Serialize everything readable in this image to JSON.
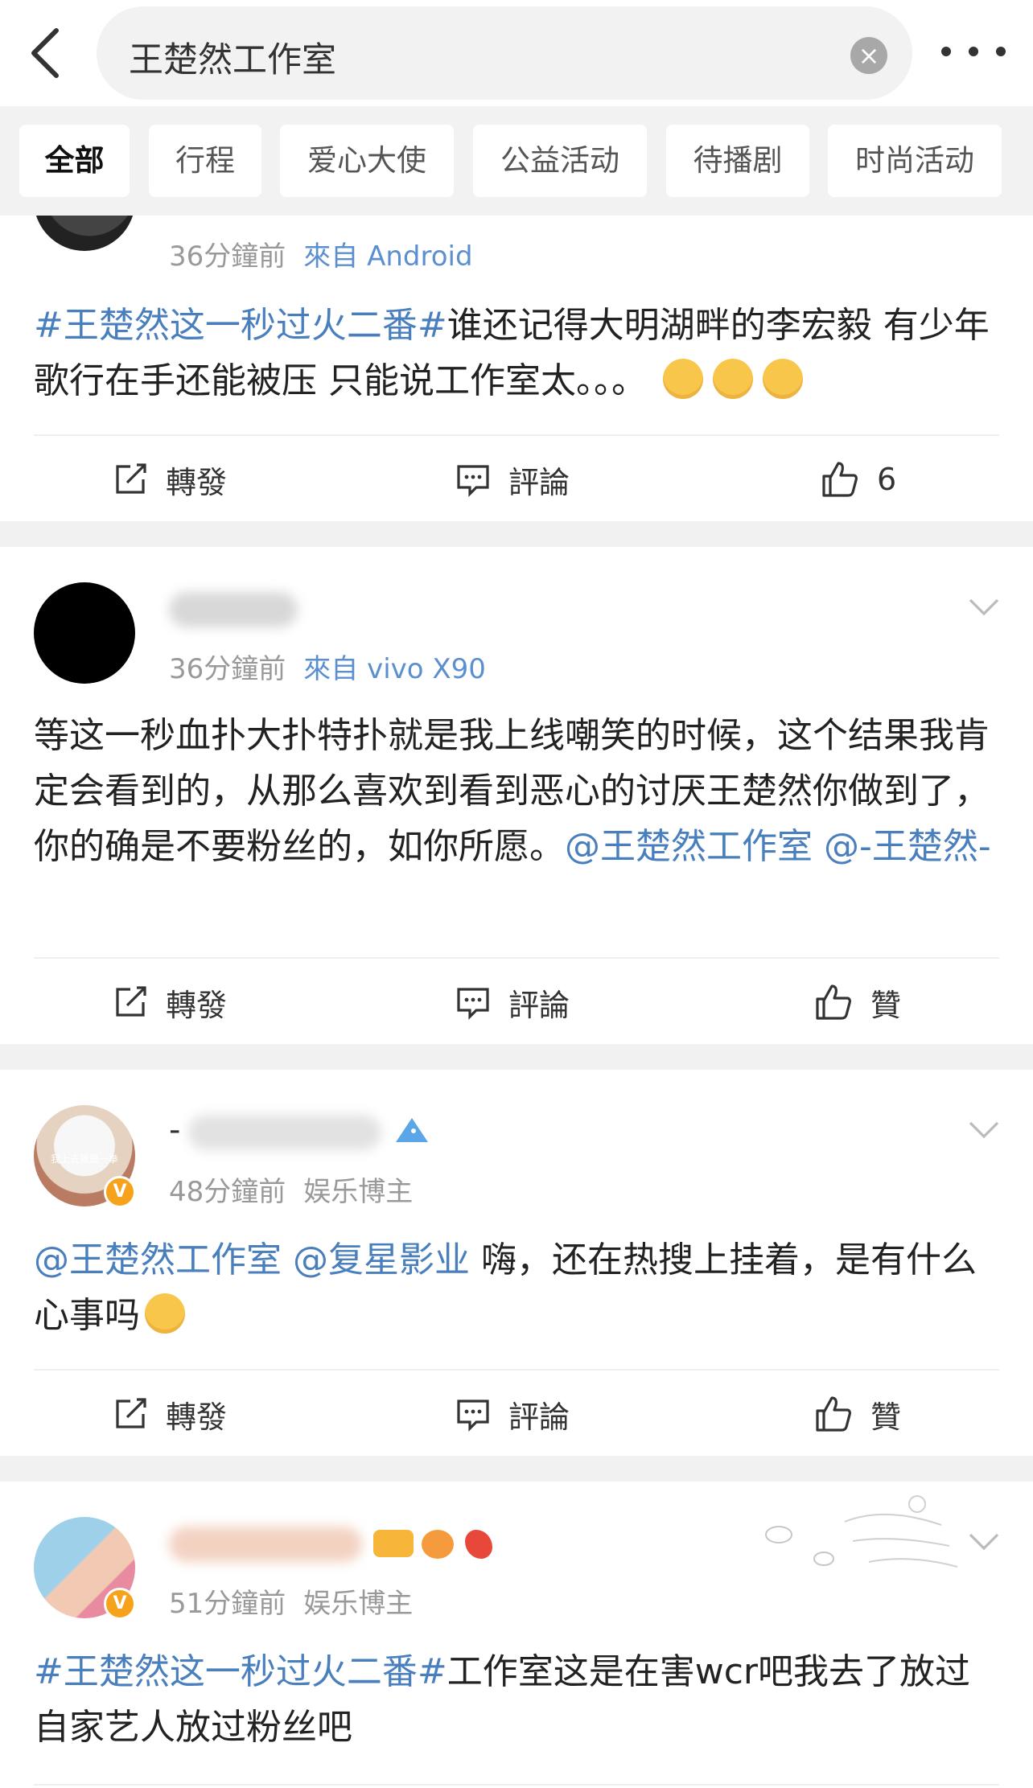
{
  "search": {
    "query": "王楚然工作室"
  },
  "tabs": [
    {
      "label": "全部",
      "active": true
    },
    {
      "label": "行程"
    },
    {
      "label": "爱心大使"
    },
    {
      "label": "公益活动"
    },
    {
      "label": "待播剧"
    },
    {
      "label": "时尚活动"
    }
  ],
  "posts": [
    {
      "time": "36分鐘前",
      "source": "來自 Android",
      "content": {
        "hashtag": "#王楚然这一秒过火二番#",
        "text": "谁还记得大明湖畔的李宏毅 有少年歌行在手还能被压 只能说工作室太。。。"
      },
      "actions": {
        "repost": "轉發",
        "comment": "評論",
        "like": "6"
      }
    },
    {
      "time": "36分鐘前",
      "source": "來自 vivo X90",
      "content": {
        "text": "等这一秒血扑大扑特扑就是我上线嘲笑的时候，这个结果我肯定会看到的，从那么喜欢到看到恶心的讨厌王楚然你做到了，你的确是不要粉丝的，如你所愿。",
        "mention1": "@王楚然工作室",
        "mention2": "@-王楚然-"
      },
      "actions": {
        "repost": "轉發",
        "comment": "評論",
        "like": "贊"
      }
    },
    {
      "name_prefix": "-",
      "time": "48分鐘前",
      "source": "娱乐博主",
      "avatar_text": "我上去就是一拳",
      "content": {
        "mention1": "@王楚然工作室",
        "mention2": "@复星影业",
        "text": "嗨，还在热搜上挂着，是有什么心事吗"
      },
      "actions": {
        "repost": "轉發",
        "comment": "評論",
        "like": "贊"
      }
    },
    {
      "time": "51分鐘前",
      "source": "娱乐博主",
      "content": {
        "hashtag": "#王楚然这一秒过火二番#",
        "text": "工作室这是在害wcr吧我去了放过自家艺人放过粉丝吧"
      }
    }
  ],
  "colors": {
    "link": "#4a7fbe",
    "badge": "#f7a21b",
    "muted": "#999999"
  },
  "icons": [
    "back-arrow-icon",
    "clear-icon",
    "more-icon",
    "repost-icon",
    "comment-icon",
    "like-icon",
    "chevron-down-icon",
    "verified-badge-icon"
  ]
}
